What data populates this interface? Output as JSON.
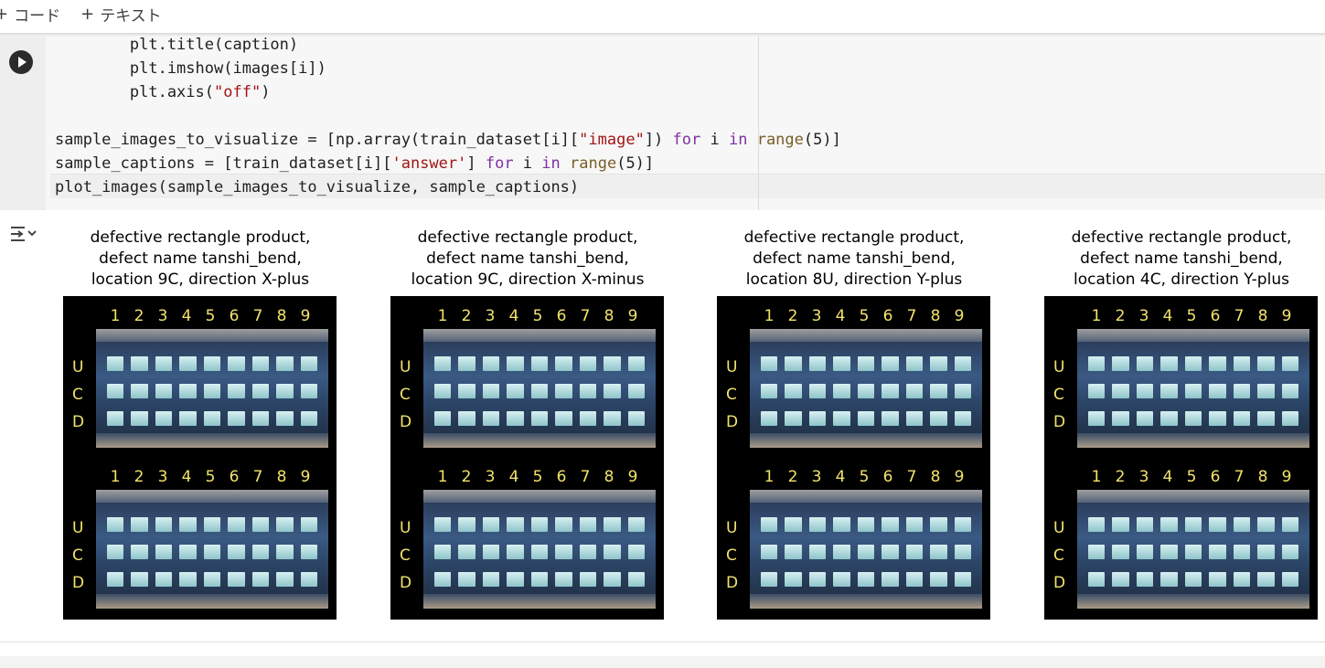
{
  "toolbar": {
    "code_label": "コード",
    "text_label": "テキスト",
    "plus": "+"
  },
  "code": {
    "lines": [
      "        plt.title(caption)",
      "        plt.imshow(images[i])",
      "        plt.axis(\"off\")",
      "",
      "sample_images_to_visualize = [np.array(train_dataset[i][\"image\"]) for i in range(5)]",
      "sample_captions = [train_dataset[i]['answer'] for i in range(5)]",
      "plot_images(sample_images_to_visualize, sample_captions)"
    ]
  },
  "output": {
    "panels": [
      {
        "caption": [
          "defective rectangle product,",
          "defect name tanshi_bend,",
          "location 9C, direction X-plus"
        ]
      },
      {
        "caption": [
          "defective rectangle product,",
          "defect name tanshi_bend,",
          "location 9C, direction X-minus"
        ]
      },
      {
        "caption": [
          "defective rectangle product,",
          "defect name tanshi_bend,",
          "location 8U, direction Y-plus"
        ]
      },
      {
        "caption": [
          "defective rectangle product,",
          "defect name tanshi_bend,",
          "location 4C, direction Y-plus"
        ]
      }
    ],
    "column_numbers": [
      "1",
      "2",
      "3",
      "4",
      "5",
      "6",
      "7",
      "8",
      "9"
    ],
    "row_letters": [
      "U",
      "C",
      "D"
    ]
  }
}
